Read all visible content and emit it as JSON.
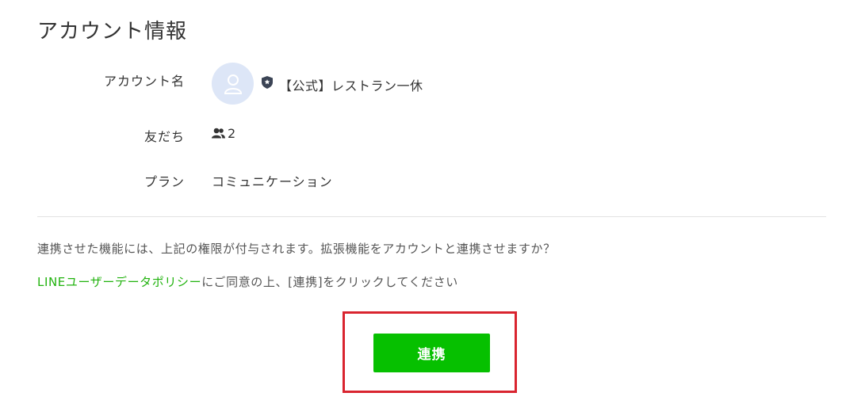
{
  "page": {
    "title": "アカウント情報"
  },
  "account": {
    "name_label": "アカウント名",
    "name": "【公式】レストラン一休",
    "friends_label": "友だち",
    "friends_count": "2",
    "plan_label": "プラン",
    "plan_value": "コミュニケーション"
  },
  "message": {
    "description": "連携させた機能には、上記の権限が付与されます。拡張機能をアカウントと連携させますか？",
    "policy_link": "LINEユーザーデータポリシー",
    "consent_suffix": "にご同意の上、[連携]をクリックしてください"
  },
  "action": {
    "connect_label": "連携"
  },
  "colors": {
    "accent": "#06c000",
    "link": "#22b30f",
    "highlight": "#d9242f"
  },
  "icons": [
    "user-avatar-icon",
    "shield-badge-icon",
    "friends-icon"
  ]
}
